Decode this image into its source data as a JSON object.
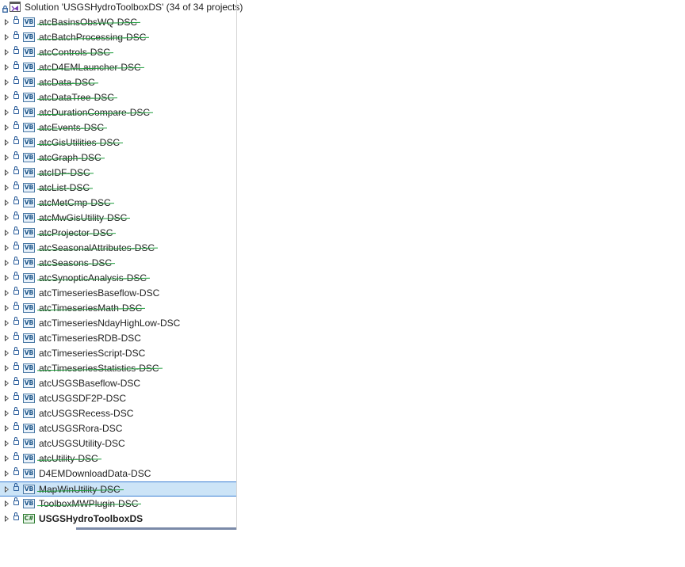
{
  "solution": {
    "label": "Solution 'USGSHydroToolboxDS' (34 of 34 projects)"
  },
  "projects": [
    {
      "name": "atcBasinsObsWQ-DSC",
      "type": "VB",
      "modified": true
    },
    {
      "name": "atcBatchProcessing-DSC",
      "type": "VB",
      "modified": true
    },
    {
      "name": "atcControls-DSC",
      "type": "VB",
      "modified": true
    },
    {
      "name": "atcD4EMLauncher-DSC",
      "type": "VB",
      "modified": true
    },
    {
      "name": "atcData-DSC",
      "type": "VB",
      "modified": true
    },
    {
      "name": "atcDataTree-DSC",
      "type": "VB",
      "modified": true
    },
    {
      "name": "atcDurationCompare-DSC",
      "type": "VB",
      "modified": true
    },
    {
      "name": "atcEvents-DSC",
      "type": "VB",
      "modified": true
    },
    {
      "name": "atcGisUtilities-DSC",
      "type": "VB",
      "modified": true
    },
    {
      "name": "atcGraph-DSC",
      "type": "VB",
      "modified": true
    },
    {
      "name": "atcIDF-DSC",
      "type": "VB",
      "modified": true
    },
    {
      "name": "atcList-DSC",
      "type": "VB",
      "modified": true
    },
    {
      "name": "atcMetCmp-DSC",
      "type": "VB",
      "modified": true
    },
    {
      "name": "atcMwGisUtility-DSC",
      "type": "VB",
      "modified": true
    },
    {
      "name": "atcProjector-DSC",
      "type": "VB",
      "modified": true
    },
    {
      "name": "atcSeasonalAttributes-DSC",
      "type": "VB",
      "modified": true
    },
    {
      "name": "atcSeasons-DSC",
      "type": "VB",
      "modified": true
    },
    {
      "name": "atcSynopticAnalysis-DSC",
      "type": "VB",
      "modified": true
    },
    {
      "name": "atcTimeseriesBaseflow-DSC",
      "type": "VB",
      "modified": false
    },
    {
      "name": "atcTimeseriesMath-DSC",
      "type": "VB",
      "modified": true
    },
    {
      "name": "atcTimeseriesNdayHighLow-DSC",
      "type": "VB",
      "modified": false
    },
    {
      "name": "atcTimeseriesRDB-DSC",
      "type": "VB",
      "modified": false
    },
    {
      "name": "atcTimeseriesScript-DSC",
      "type": "VB",
      "modified": false
    },
    {
      "name": "atcTimeseriesStatistics-DSC",
      "type": "VB",
      "modified": true
    },
    {
      "name": "atcUSGSBaseflow-DSC",
      "type": "VB",
      "modified": false
    },
    {
      "name": "atcUSGSDF2P-DSC",
      "type": "VB",
      "modified": false
    },
    {
      "name": "atcUSGSRecess-DSC",
      "type": "VB",
      "modified": false
    },
    {
      "name": "atcUSGSRora-DSC",
      "type": "VB",
      "modified": false
    },
    {
      "name": "atcUSGSUtility-DSC",
      "type": "VB",
      "modified": false
    },
    {
      "name": "atcUtility-DSC",
      "type": "VB",
      "modified": true
    },
    {
      "name": "D4EMDownloadData-DSC",
      "type": "VB",
      "modified": false
    },
    {
      "name": "MapWinUtility-DSC",
      "type": "VB",
      "modified": true,
      "selected": true
    },
    {
      "name": "ToolboxMWPlugin-DSC",
      "type": "VB",
      "modified": true
    },
    {
      "name": "USGSHydroToolboxDS",
      "type": "C#",
      "modified": false,
      "bold": true
    }
  ],
  "colors": {
    "selection": "#cce4f7",
    "strike": "#1e9e3c",
    "vb_icon": "#1a5488",
    "cs_icon": "#1f6b23"
  }
}
